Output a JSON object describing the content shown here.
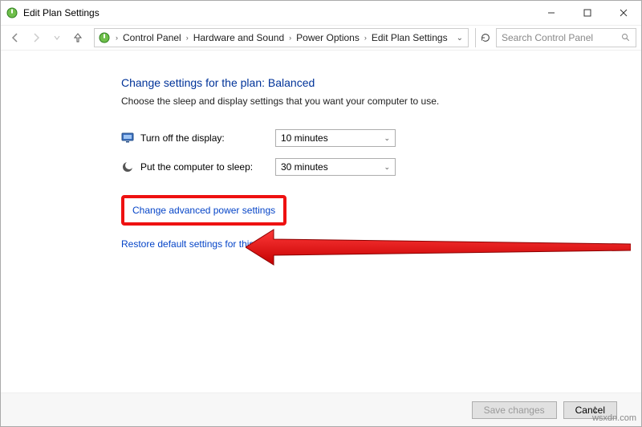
{
  "window": {
    "title": "Edit Plan Settings"
  },
  "breadcrumb": {
    "items": [
      "Control Panel",
      "Hardware and Sound",
      "Power Options",
      "Edit Plan Settings"
    ]
  },
  "search": {
    "placeholder": "Search Control Panel"
  },
  "page": {
    "heading": "Change settings for the plan: Balanced",
    "description": "Choose the sleep and display settings that you want your computer to use."
  },
  "settings": {
    "display_off": {
      "label": "Turn off the display:",
      "value": "10 minutes"
    },
    "sleep": {
      "label": "Put the computer to sleep:",
      "value": "30 minutes"
    }
  },
  "links": {
    "advanced": "Change advanced power settings",
    "restore": "Restore default settings for this plan"
  },
  "buttons": {
    "save": "Save changes",
    "cancel": "Cancel"
  },
  "watermark": "wsxdn.com"
}
